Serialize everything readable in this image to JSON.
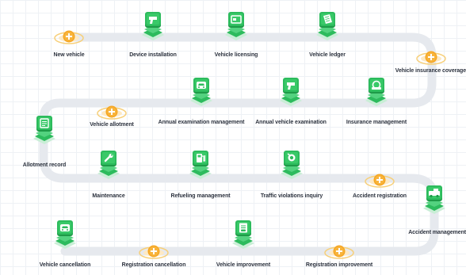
{
  "colors": {
    "path": "#e6e9ee",
    "icon_green": "#2dbb5d",
    "icon_dark": "#1e9a48",
    "icon_light": "#53d27f",
    "plus_orange": "#f5a623",
    "ring": "#f7cf78"
  },
  "steps": [
    {
      "label": "New vehicle",
      "icon": "plus-icon"
    },
    {
      "label": "Device installation",
      "icon": "spray-gun-icon"
    },
    {
      "label": "Vehicle licensing",
      "icon": "license-card-icon"
    },
    {
      "label": "Vehicle ledger",
      "icon": "ledger-book-icon"
    },
    {
      "label": "Vehicle insurance coverage",
      "icon": "plus-icon"
    },
    {
      "label": "Insurance management",
      "icon": "insurance-icon"
    },
    {
      "label": "Annual vehicle examination",
      "icon": "spray-gun-icon"
    },
    {
      "label": "Annual examination management",
      "icon": "car-badge-icon"
    },
    {
      "label": "Vehicle allotment",
      "icon": "plus-icon"
    },
    {
      "label": "Allotment record",
      "icon": "record-list-icon"
    },
    {
      "label": "Maintenance",
      "icon": "wrench-icon"
    },
    {
      "label": "Refueling management",
      "icon": "fuel-pump-icon"
    },
    {
      "label": "Traffic violations inquiry",
      "icon": "camera-icon"
    },
    {
      "label": "Accident registration",
      "icon": "plus-icon"
    },
    {
      "label": "Accident management",
      "icon": "tow-truck-icon"
    },
    {
      "label": "Registration improvement",
      "icon": "plus-icon"
    },
    {
      "label": "Vehicle improvement",
      "icon": "document-car-icon"
    },
    {
      "label": "Registration cancellation",
      "icon": "plus-icon"
    },
    {
      "label": "Vehicle cancellation",
      "icon": "car-cancel-icon"
    }
  ]
}
